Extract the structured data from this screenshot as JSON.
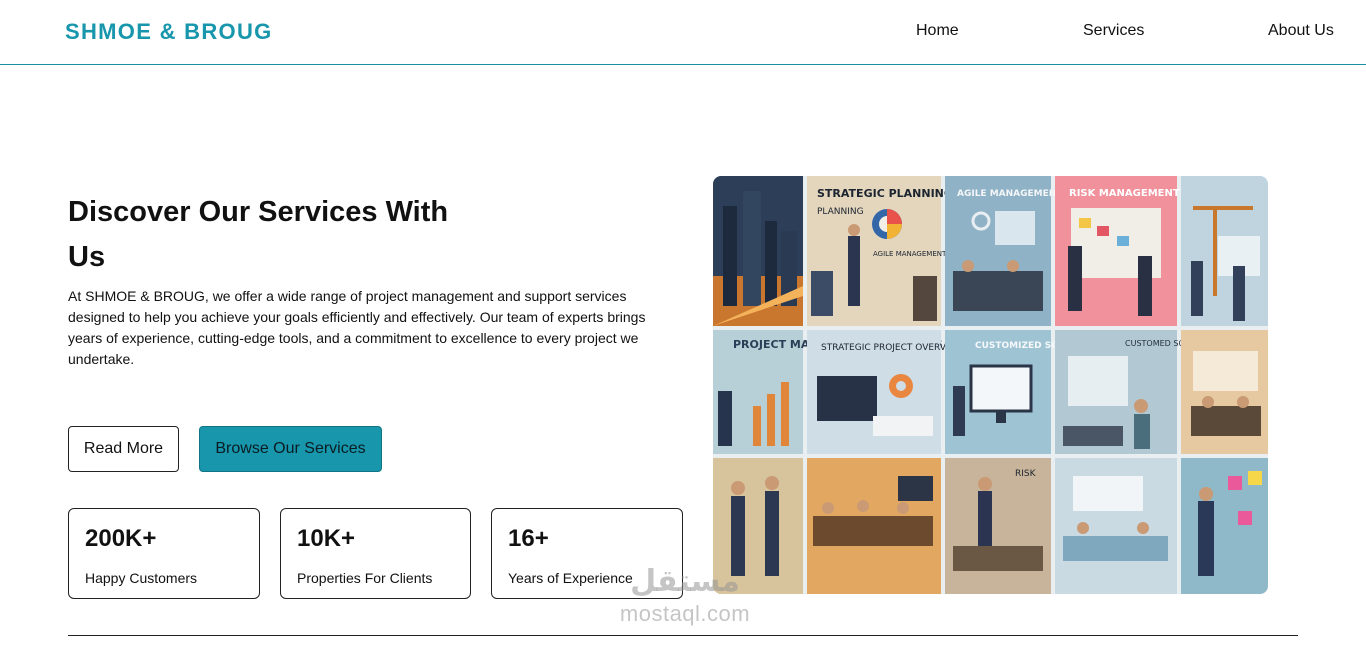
{
  "brand": {
    "name": "SHMOE & BROUG",
    "color": "#1796ac"
  },
  "nav": {
    "home": "Home",
    "services": "Services",
    "about": "About Us"
  },
  "hero": {
    "title": "Discover Our Services With Us",
    "description": "At SHMOE & BROUG, we offer a wide range of project management and support services designed to help you achieve your goals efficiently and effectively. Our team of experts brings years of experience, cutting-edge tools, and a commitment to excellence to every project we undertake."
  },
  "buttons": {
    "read_more": "Read More",
    "browse": "Browse Our Services"
  },
  "stats": [
    {
      "value": "200K+",
      "label": "Happy Customers"
    },
    {
      "value": "10K+",
      "label": "Properties For Clients"
    },
    {
      "value": "16+",
      "label": "Years of Experience"
    }
  ],
  "collage": {
    "top_row": [
      "STRATEGIC PLANNING",
      "PLANNING",
      "AGILE MANAGEMENT",
      "AGILE MANAGEMENT",
      "RISK MANAGEMENT"
    ],
    "middle_row": [
      "PROJECT MANAGEMENT SERVICES",
      "STRATEGIC PROJECT OVERVICIT",
      "CUSTOMIZED SOLUTIONS",
      "CUSTOMED SOLUTIONS"
    ],
    "bottom_row": [
      "RISK"
    ]
  },
  "watermark": {
    "arabic": "مستقل",
    "site": "mostaql.com"
  }
}
